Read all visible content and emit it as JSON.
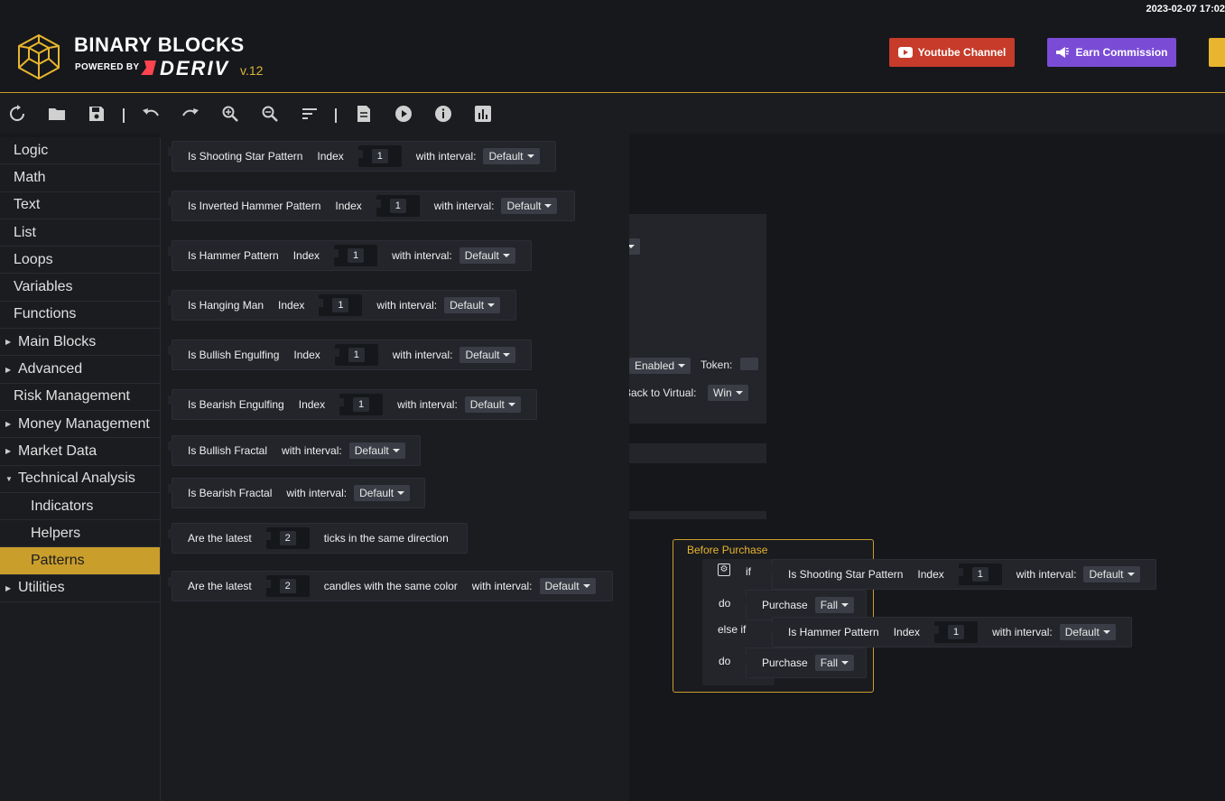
{
  "header": {
    "datetime": "2023-02-07 17:02",
    "brand_title": "BINARY BLOCKS",
    "powered_by": "POWERED BY",
    "deriv": "DERIV",
    "version": "v.12",
    "youtube_label": "Youtube Channel",
    "earn_label": "Earn Commission"
  },
  "toolbar": {
    "items": [
      "reset",
      "open",
      "save",
      "undo",
      "redo",
      "zoom-in",
      "zoom-out",
      "sort",
      "logs",
      "run",
      "info",
      "chart"
    ]
  },
  "sidebar": {
    "items": [
      {
        "label": "Logic"
      },
      {
        "label": "Math"
      },
      {
        "label": "Text"
      },
      {
        "label": "List"
      },
      {
        "label": "Loops"
      },
      {
        "label": "Variables"
      },
      {
        "label": "Functions"
      },
      {
        "label": "Main Blocks"
      },
      {
        "label": "Advanced"
      },
      {
        "label": "Risk Management"
      },
      {
        "label": "Money Management"
      },
      {
        "label": "Market Data"
      },
      {
        "label": "Technical Analysis"
      },
      {
        "label": "Indicators"
      },
      {
        "label": "Helpers"
      },
      {
        "label": "Patterns"
      },
      {
        "label": "Utilities"
      }
    ]
  },
  "flyout": {
    "blocks": [
      {
        "name": "Is Shooting Star Pattern",
        "index_label": "Index",
        "index": "1",
        "interval_label": "with interval:",
        "interval": "Default"
      },
      {
        "name": "Is Inverted Hammer Pattern",
        "index_label": "Index",
        "index": "1",
        "interval_label": "with interval:",
        "interval": "Default"
      },
      {
        "name": "Is Hammer Pattern",
        "index_label": "Index",
        "index": "1",
        "interval_label": "with interval:",
        "interval": "Default"
      },
      {
        "name": "Is Hanging Man",
        "index_label": "Index",
        "index": "1",
        "interval_label": "with interval:",
        "interval": "Default"
      },
      {
        "name": "Is Bullish Engulfing",
        "index_label": "Index",
        "index": "1",
        "interval_label": "with interval:",
        "interval": "Default"
      },
      {
        "name": "Is Bearish Engulfing",
        "index_label": "Index",
        "index": "1",
        "interval_label": "with interval:",
        "interval": "Default"
      },
      {
        "name": "Is Bullish Fractal",
        "interval_label": "with interval:",
        "interval": "Default"
      },
      {
        "name": "Is Bearish Fractal",
        "interval_label": "with interval:",
        "interval": "Default"
      },
      {
        "prefix": "Are the latest",
        "count": "2",
        "suffix": "ticks in the same direction"
      },
      {
        "prefix": "Are the latest",
        "count": "2",
        "suffix": "candles with the same color",
        "interval_label": "with interval:",
        "interval": "Default"
      }
    ]
  },
  "canvas": {
    "partial": {
      "dropdown_enabled": "Enabled",
      "token_label": "Token:",
      "back_to_virtual_label": "Back to Virtual:",
      "back_to_virtual_value": "Win"
    },
    "before_purchase": {
      "title": "Before Purchase",
      "if_kw": "if",
      "else_if_kw": "else if",
      "do_kw": "do",
      "cond1": {
        "name": "Is Shooting Star Pattern",
        "index_label": "Index",
        "index": "1",
        "interval_label": "with interval:",
        "interval": "Default"
      },
      "cond2": {
        "name": "Is Hammer Pattern",
        "index_label": "Index",
        "index": "1",
        "interval_label": "with interval:",
        "interval": "Default"
      },
      "purchase_label": "Purchase",
      "purchase1": "Fall",
      "purchase2": "Fall"
    }
  }
}
